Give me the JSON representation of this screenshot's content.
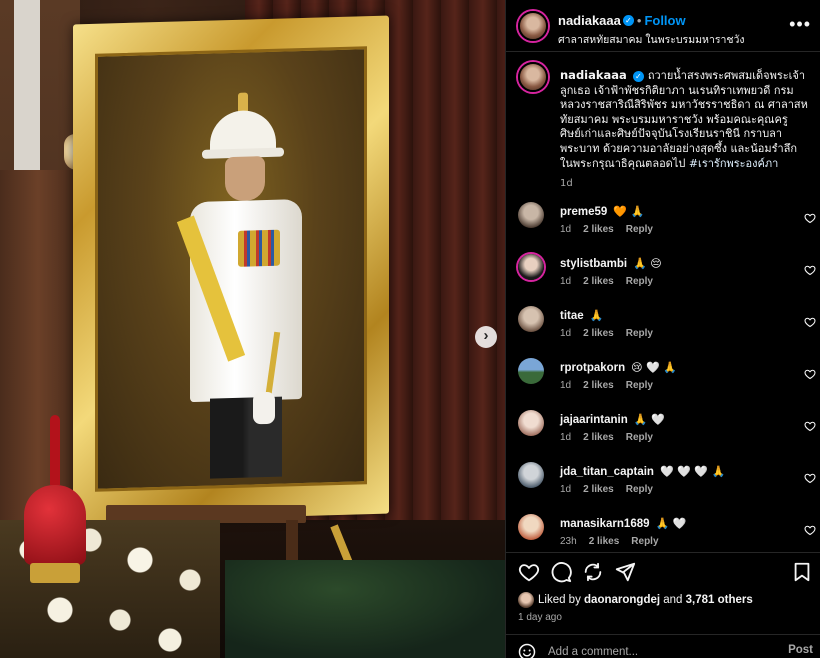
{
  "post": {
    "username": "nadiakaaa",
    "follow_label": "Follow",
    "separator": "•",
    "location": "ศาลาสหทัยสมาคม ในพระบรมมหาราชวัง",
    "more_label": "•••"
  },
  "caption": {
    "username": "nadiakaaa",
    "text": "ถวายน้ำสรงพระศพสมเด็จพระเจ้าลูกเธอ เจ้าฟ้าพัชรกิติยาภา นเรนทิราเทพยวดี กรมหลวงราชสาริณีสิริพัชร มหาวัชรราชธิดา ณ ศาลาสหทัยสมาคม พระบรมมหาราชวัง พร้อมคณะคุณครู ศิษย์เก่าและศิษย์ปัจจุบันโรงเรียนราชินี กราบลาพระบาท ด้วยความอาลัยอย่างสุดซึ้ง และน้อมรำลึกในพระกรุณาธิคุณตลอดไป ",
    "hashtag": "#เรารักพระองค์ภา",
    "time": "1d"
  },
  "comments": [
    {
      "username": "preme59",
      "text": "🧡 🙏",
      "time": "1d",
      "likes": "2 likes",
      "reply": "Reply"
    },
    {
      "username": "stylistbambi",
      "text": "🙏 😔",
      "time": "1d",
      "likes": "2 likes",
      "reply": "Reply"
    },
    {
      "username": "titae",
      "text": "🙏",
      "time": "1d",
      "likes": "2 likes",
      "reply": "Reply"
    },
    {
      "username": "rprotpakorn",
      "text": "😢 🤍 🙏",
      "time": "1d",
      "likes": "2 likes",
      "reply": "Reply"
    },
    {
      "username": "jajaarintanin",
      "text": "🙏 🤍",
      "time": "1d",
      "likes": "2 likes",
      "reply": "Reply"
    },
    {
      "username": "jda_titan_captain",
      "text": "🤍 🤍 🤍 🙏",
      "time": "1d",
      "likes": "2 likes",
      "reply": "Reply"
    },
    {
      "username": "manasikarn1689",
      "text": "🙏 🤍",
      "time": "23h",
      "likes": "2 likes",
      "reply": "Reply"
    }
  ],
  "likes": {
    "prefix": "Liked by ",
    "user": "daonarongdej",
    "middle": " and ",
    "others": "3,781 others"
  },
  "posted_ago": "1 day ago",
  "add_comment": {
    "placeholder": "Add a comment...",
    "post_label": "Post"
  },
  "colors": {
    "accent": "#0095f6",
    "background": "#000000",
    "muted": "#a8a8a8"
  },
  "icons": [
    "more-icon",
    "verified-icon",
    "heart-icon",
    "comment-icon",
    "share-icon",
    "save-icon",
    "emoji-icon",
    "next-icon"
  ]
}
